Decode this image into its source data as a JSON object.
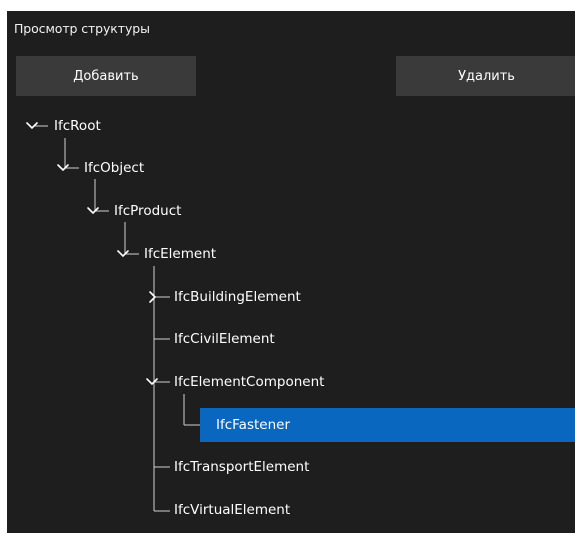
{
  "panel": {
    "title": "Просмотр структуры"
  },
  "toolbar": {
    "add_label": "Добавить",
    "delete_label": "Удалить"
  },
  "tree": {
    "nodes": [
      {
        "label": "IfcRoot",
        "state": "expanded"
      },
      {
        "label": "IfcObject",
        "state": "expanded"
      },
      {
        "label": "IfcProduct",
        "state": "expanded"
      },
      {
        "label": "IfcElement",
        "state": "expanded"
      },
      {
        "label": "IfcBuildingElement",
        "state": "collapsed"
      },
      {
        "label": "IfcCivilElement",
        "state": "leaf"
      },
      {
        "label": "IfcElementComponent",
        "state": "expanded"
      },
      {
        "label": "IfcFastener",
        "state": "leaf",
        "selected": true
      },
      {
        "label": "IfcTransportElement",
        "state": "leaf"
      },
      {
        "label": "IfcVirtualElement",
        "state": "leaf"
      }
    ]
  },
  "colors": {
    "panel_bg": "#1e1e1e",
    "button_bg": "#3a3a3a",
    "selection_bg": "#0a67bf",
    "line_color": "#d0d0d0"
  }
}
